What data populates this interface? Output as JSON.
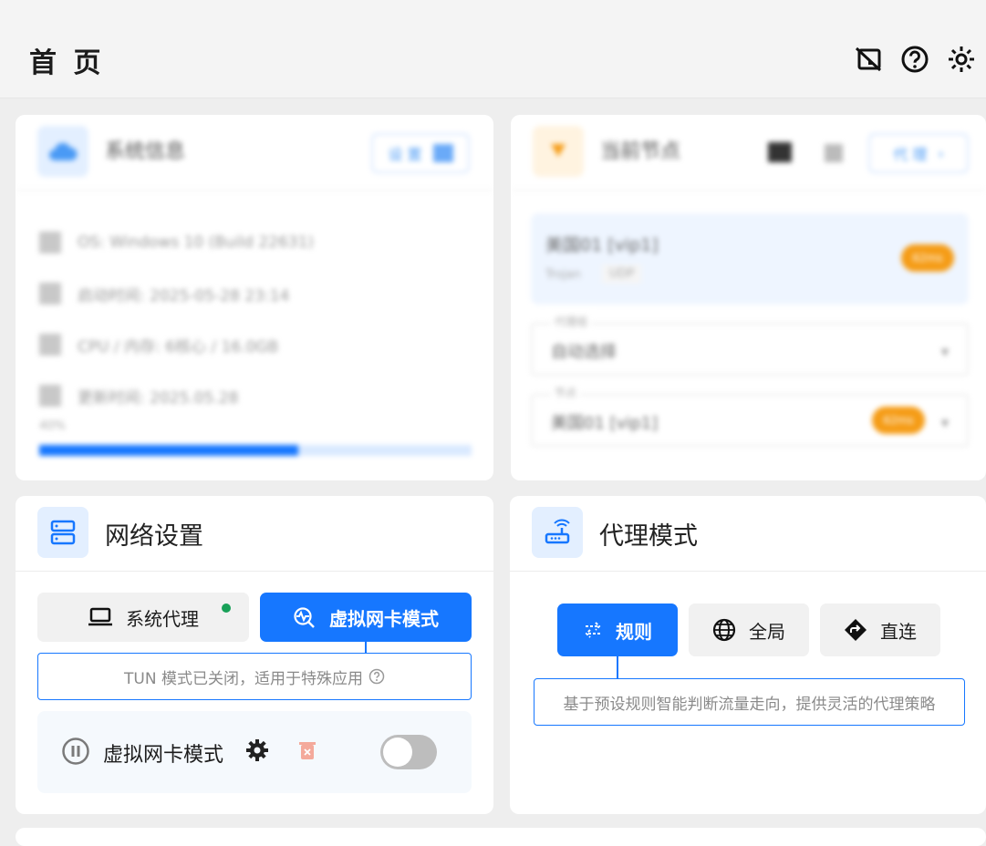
{
  "header": {
    "title": "首 页"
  },
  "system_card": {
    "title": "系统信息",
    "action_label": "设 置",
    "rows": [
      "OS: Windows 10 (Build 22631)",
      "启动时间: 2025-05-28 23:14",
      "CPU / 内存: 6核心 / 16.0GB",
      "更新时间: 2025.05.28"
    ],
    "usage_label": "40%",
    "usage_fraction": 0.6
  },
  "current_node_card": {
    "title": "当前节点",
    "action_label": "代 理",
    "node_name": "美国01 [vip1]",
    "node_type": "Trojan",
    "node_protocol": "UDP",
    "node_badge": "62ms",
    "group_label": "代理组",
    "group_value": "自动选择",
    "node_label": "节点",
    "node_value": "美国01 [vip1]",
    "node_value_badge": "62ms"
  },
  "network_card": {
    "title": "网络设置",
    "tab_system_proxy": "系统代理",
    "tab_tun": "虚拟网卡模式",
    "hint": "TUN 模式已关闭，适用于特殊应用",
    "row_label": "虚拟网卡模式",
    "toggle_on": false
  },
  "proxy_mode_card": {
    "title": "代理模式",
    "btn_rule": "规则",
    "btn_global": "全局",
    "btn_direct": "直连",
    "hint": "基于预设规则智能判断流量走向，提供灵活的代理策略"
  },
  "colors": {
    "accent": "#1677ff",
    "status_green": "#18a058",
    "badge_orange": "#f59c16"
  }
}
